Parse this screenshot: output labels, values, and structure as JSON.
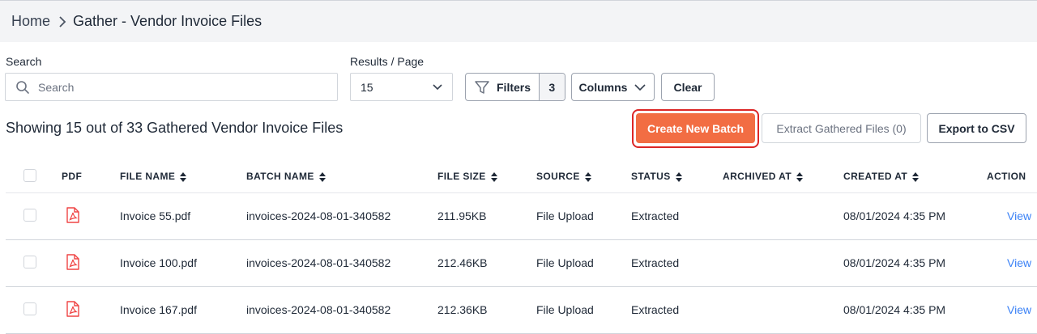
{
  "breadcrumb": {
    "home": "Home",
    "current": "Gather - Vendor Invoice Files"
  },
  "search": {
    "label": "Search",
    "placeholder": "Search",
    "value": ""
  },
  "results_per_page": {
    "label": "Results / Page",
    "value": "15"
  },
  "toolbar": {
    "filters_label": "Filters",
    "filters_count": "3",
    "columns_label": "Columns",
    "clear_label": "Clear",
    "create_batch_label": "Create New Batch",
    "extract_label": "Extract Gathered Files (0)",
    "export_label": "Export to CSV"
  },
  "summary": "Showing 15 out of 33 Gathered Vendor Invoice Files",
  "colors": {
    "accent": "#f26d43",
    "highlight": "#dc2626",
    "link": "#3b82f6",
    "pdf_icon": "#ef4444"
  },
  "table": {
    "headers": [
      "PDF",
      "FILE NAME",
      "BATCH NAME",
      "FILE SIZE",
      "SOURCE",
      "STATUS",
      "ARCHIVED AT",
      "CREATED AT",
      "ACTION"
    ],
    "rows": [
      {
        "file_name": "Invoice 55.pdf",
        "batch_name": "invoices-2024-08-01-340582",
        "file_size": "211.95KB",
        "source": "File Upload",
        "status": "Extracted",
        "archived_at": "",
        "created_at": "08/01/2024 4:35 PM",
        "action": "View"
      },
      {
        "file_name": "Invoice 100.pdf",
        "batch_name": "invoices-2024-08-01-340582",
        "file_size": "212.46KB",
        "source": "File Upload",
        "status": "Extracted",
        "archived_at": "",
        "created_at": "08/01/2024 4:35 PM",
        "action": "View"
      },
      {
        "file_name": "Invoice 167.pdf",
        "batch_name": "invoices-2024-08-01-340582",
        "file_size": "212.36KB",
        "source": "File Upload",
        "status": "Extracted",
        "archived_at": "",
        "created_at": "08/01/2024 4:35 PM",
        "action": "View"
      }
    ]
  }
}
